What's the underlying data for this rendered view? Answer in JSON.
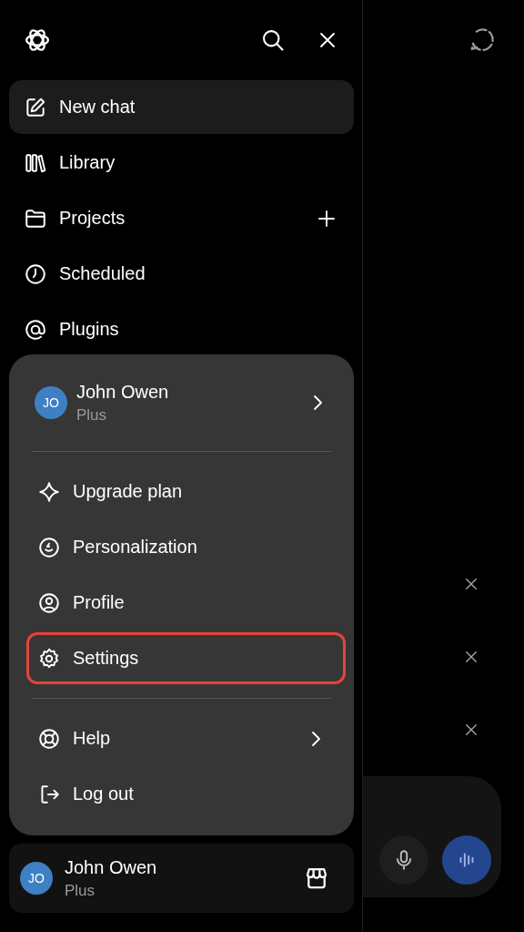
{
  "nav": [
    {
      "label": "New chat",
      "selected": true
    },
    {
      "label": "Library",
      "selected": false
    },
    {
      "label": "Projects",
      "selected": false,
      "add_button": true
    },
    {
      "label": "Scheduled",
      "selected": false
    },
    {
      "label": "Plugins",
      "selected": false
    }
  ],
  "menu": {
    "account": {
      "initials": "JO",
      "name": "John Owen",
      "plan": "Plus",
      "submenu": true
    },
    "items": [
      {
        "label": "Upgrade plan",
        "highlighted": false
      },
      {
        "label": "Personalization",
        "highlighted": false
      },
      {
        "label": "Profile",
        "highlighted": false
      },
      {
        "label": "Settings",
        "highlighted": true
      }
    ],
    "footer_items": [
      {
        "label": "Help",
        "submenu": true
      },
      {
        "label": "Log out",
        "submenu": false
      }
    ]
  },
  "account_bar": {
    "initials": "JO",
    "name": "John Owen",
    "plan": "Plus"
  }
}
